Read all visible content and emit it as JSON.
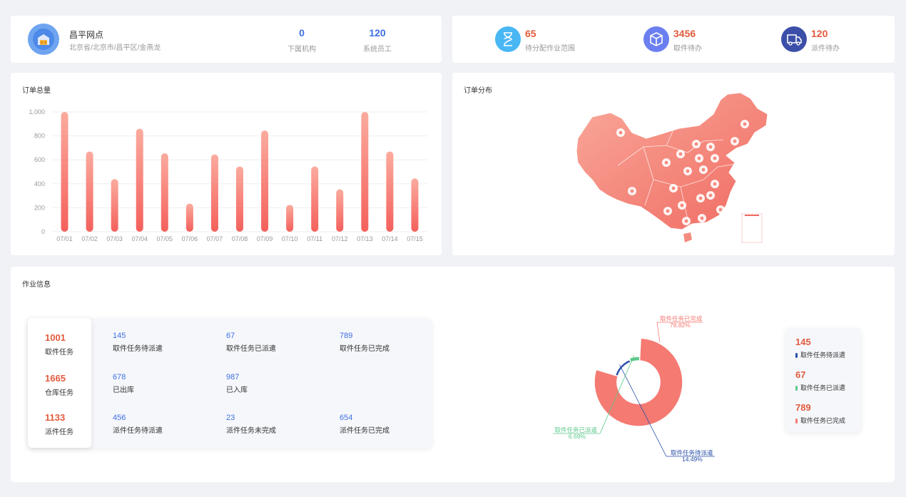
{
  "site": {
    "name": "昌平网点",
    "address": "北京省/北京市/昌平区/金燕龙",
    "kpis": [
      {
        "value": "0",
        "label": "下属机构"
      },
      {
        "value": "120",
        "label": "系统员工"
      }
    ]
  },
  "stats": [
    {
      "value": "65",
      "label": "待分配作业范围",
      "icon": "hourglass-icon",
      "color": "#4ab7f5"
    },
    {
      "value": "3456",
      "label": "取件待办",
      "icon": "box-icon",
      "color": "#6b7ff0"
    },
    {
      "value": "120",
      "label": "派件待办",
      "icon": "truck-icon",
      "color": "#3c4fa8"
    }
  ],
  "bar_chart": {
    "title": "订单总量"
  },
  "map": {
    "title": "订单分布"
  },
  "work": {
    "title": "作业信息",
    "groups": [
      {
        "value": "1001",
        "label": "取件任务",
        "items": [
          {
            "value": "145",
            "label": "取件任务待派遣"
          },
          {
            "value": "67",
            "label": "取件任务已派遣"
          },
          {
            "value": "789",
            "label": "取件任务已完成"
          }
        ]
      },
      {
        "value": "1665",
        "label": "仓库任务",
        "items": [
          {
            "value": "678",
            "label": "已出库"
          },
          {
            "value": "987",
            "label": "已入库"
          }
        ]
      },
      {
        "value": "1133",
        "label": "派件任务",
        "items": [
          {
            "value": "456",
            "label": "派件任务待派遣"
          },
          {
            "value": "23",
            "label": "派件任务未完成"
          },
          {
            "value": "654",
            "label": "派件任务已完成"
          }
        ]
      }
    ],
    "legend": [
      {
        "value": "145",
        "label": "取件任务待派遣",
        "color": "#2a4fa8"
      },
      {
        "value": "67",
        "label": "取件任务已派遣",
        "color": "#5cc98a"
      },
      {
        "value": "789",
        "label": "取件任务已完成",
        "color": "#f47a72"
      }
    ]
  },
  "chart_data": [
    {
      "type": "bar",
      "title": "订单总量",
      "categories": [
        "07/01",
        "07/02",
        "07/03",
        "07/04",
        "07/05",
        "07/06",
        "07/07",
        "07/08",
        "07/09",
        "07/10",
        "07/11",
        "07/12",
        "07/13",
        "07/14",
        "07/15"
      ],
      "values": [
        1000,
        670,
        440,
        860,
        655,
        235,
        645,
        545,
        845,
        225,
        545,
        355,
        1000,
        670,
        445
      ],
      "y_ticks": [
        "0",
        "200",
        "400",
        "600",
        "800",
        "1,000"
      ],
      "ylim": [
        0,
        1000
      ],
      "grid": true,
      "colors": {
        "top": "#fbab9e",
        "bottom": "#f4605c"
      }
    },
    {
      "type": "pie",
      "donut": true,
      "slices": [
        {
          "label": "取件任务已完成",
          "percent": "78.82%",
          "value": 78.82,
          "color": "#f47a72"
        },
        {
          "label": "取件任务待派遣",
          "percent": "14.49%",
          "value": 14.49,
          "color": "#2a4fa8"
        },
        {
          "label": "取件任务已派遣",
          "percent": "6.69%",
          "value": 6.69,
          "color": "#5cc98a"
        }
      ]
    }
  ]
}
